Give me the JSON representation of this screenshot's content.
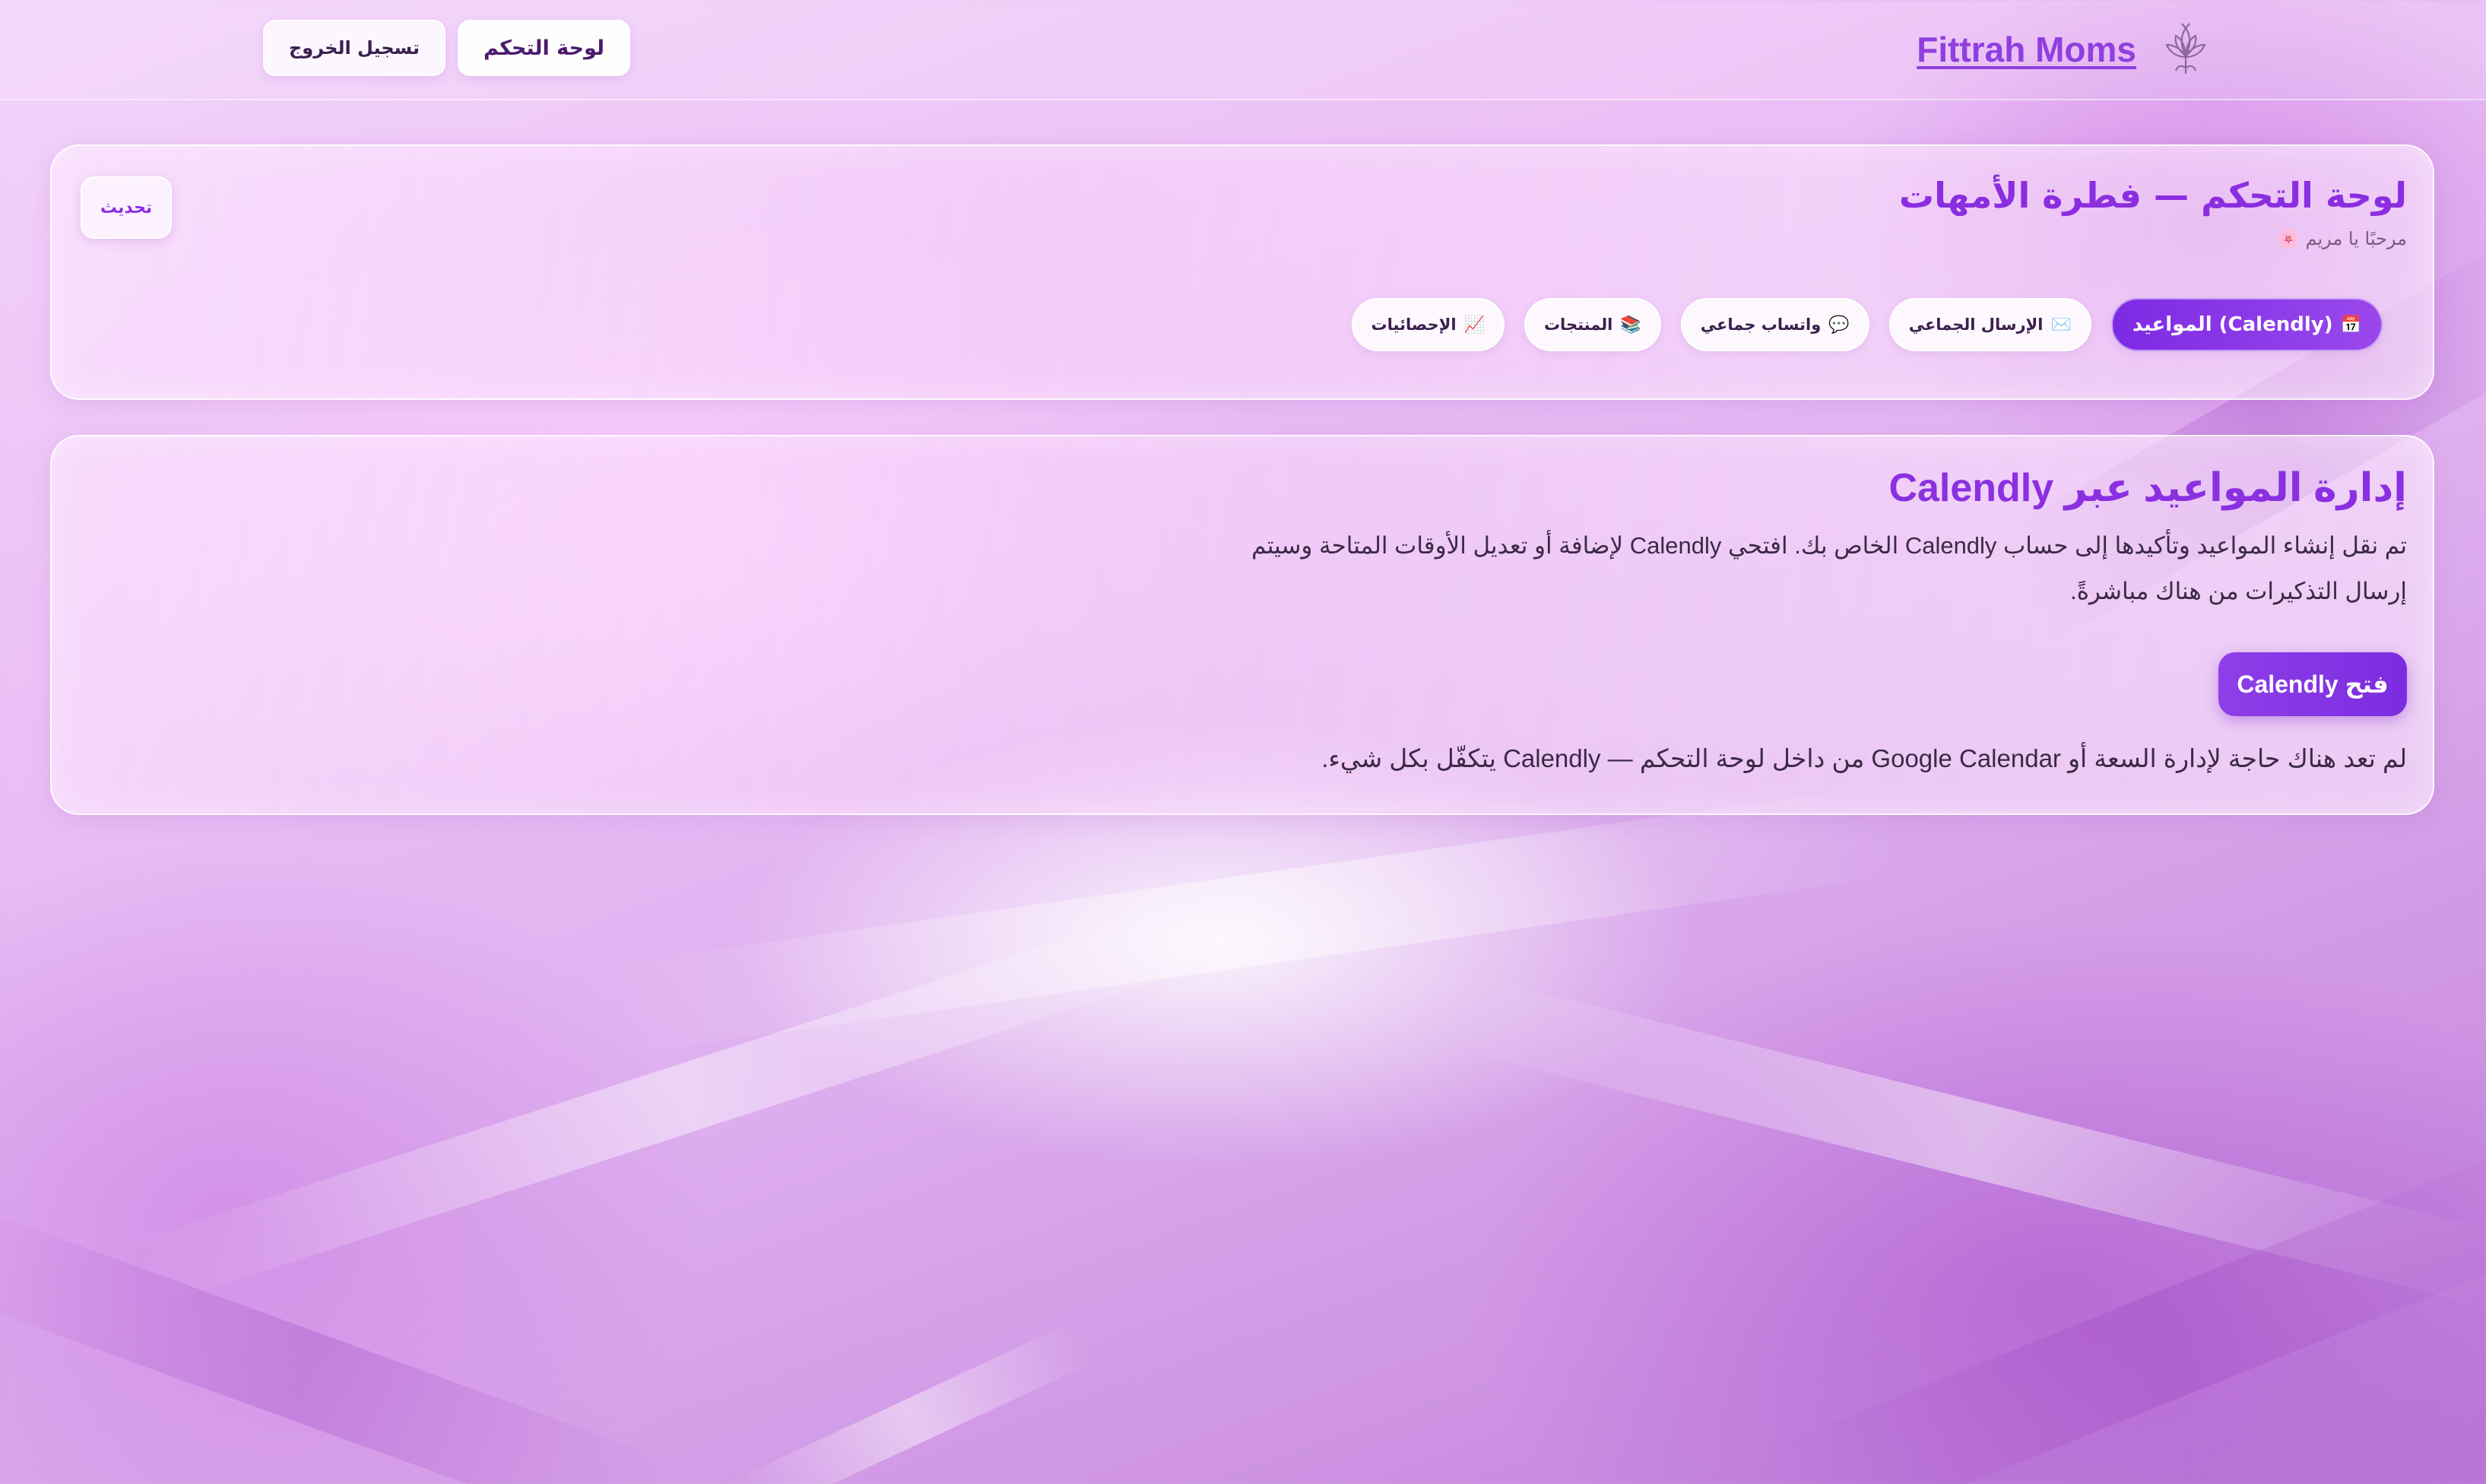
{
  "topbar": {
    "brand_name": "Fittrah Moms",
    "brand_logo_icon": "lotus-flower-icon",
    "dashboard_button": "لوحة التحكم",
    "logout_button": "تسجيل الخروج"
  },
  "header_card": {
    "title": "لوحة التحكم — فطرة الأمهات",
    "subtitle": "مرحبًا يا مريم 🌸",
    "refresh_button": "تحديث",
    "tabs": [
      {
        "icon": "📅",
        "icon_name": "calendar-icon",
        "label": "المواعيد (Calendly)",
        "active": true
      },
      {
        "icon": "✉️",
        "icon_name": "envelope-icon",
        "label": "الإرسال الجماعي",
        "active": false
      },
      {
        "icon": "💬",
        "icon_name": "speech-bubble-icon",
        "label": "واتساب جماعي",
        "active": false
      },
      {
        "icon": "📚",
        "icon_name": "books-icon",
        "label": "المنتجات",
        "active": false
      },
      {
        "icon": "📈",
        "icon_name": "chart-increasing-icon",
        "label": "الإحصائيات",
        "active": false
      }
    ]
  },
  "main_card": {
    "title": "إدارة المواعيد عبر Calendly",
    "description": "تم نقل إنشاء المواعيد وتأكيدها إلى حساب Calendly الخاص بك. افتحي Calendly لإضافة أو تعديل الأوقات المتاحة وسيتم إرسال التذكيرات من هناك مباشرةً.",
    "open_button": "فتح Calendly",
    "note": "لم تعد هناك حاجة لإدارة السعة أو Google Calendar من داخل لوحة التحكم — Calendly يتكفّل بكل شيء."
  },
  "colors": {
    "accent": "#8a2ee0",
    "active_tab_start": "#7d2ae4",
    "active_tab_end": "#9a48ec",
    "text": "#3b2a45"
  }
}
